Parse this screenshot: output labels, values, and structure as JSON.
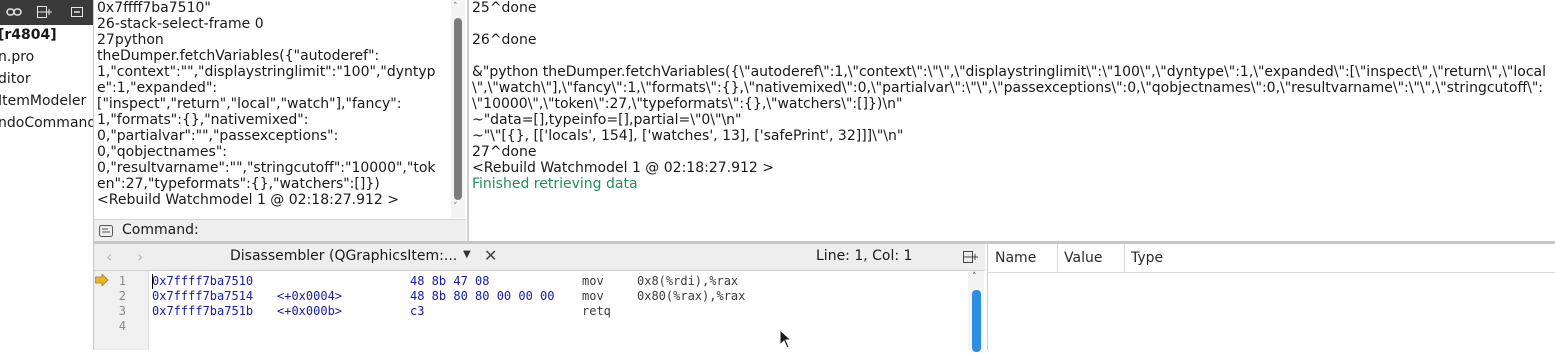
{
  "project_panel": {
    "toolbar_icons": [
      "link-icon",
      "split-icon",
      "close-pane-icon"
    ],
    "tree_items": [
      "[r4804]",
      "n.pro",
      "ditor",
      "ItemModeler",
      "ndoCommand"
    ]
  },
  "command_log": {
    "lines": [
      "0x7ffff7ba7510\"",
      "26-stack-select-frame 0",
      "27python",
      "theDumper.fetchVariables({\"autoderef\":",
      "1,\"context\":\"\",\"displaystringlimit\":\"100\",\"dyntyp",
      "e\":1,\"expanded\":",
      "[\"inspect\",\"return\",\"local\",\"watch\"],\"fancy\":",
      "1,\"formats\":{},\"nativemixed\":",
      "0,\"partialvar\":\"\",\"passexceptions\":",
      "0,\"qobjectnames\":",
      "0,\"resultvarname\":\"\",\"stringcutoff\":\"10000\",\"tok",
      "en\":27,\"typeformats\":{},\"watchers\":[]})",
      "<Rebuild Watchmodel 1 @ 02:18:27.912 >"
    ]
  },
  "command_bar": {
    "label": "Command:",
    "value": ""
  },
  "response_log": {
    "lines": [
      "25^done",
      "",
      "26^done",
      "",
      "&\"python theDumper.fetchVariables({\\\"autoderef\\\":1,\\\"context\\\":\\\"\\\",\\\"displaystringlimit\\\":\\\"100\\\",\\\"dyntype\\\":1,\\\"expanded\\\":[\\\"inspect\\\",\\\"return\\\",\\\"local",
      "\\\",\\\"watch\\\"],\\\"fancy\\\":1,\\\"formats\\\":{},\\\"nativemixed\\\":0,\\\"partialvar\\\":\\\"\\\",\\\"passexceptions\\\":0,\\\"qobjectnames\\\":0,\\\"resultvarname\\\":\\\"\\\",\\\"stringcutoff\\\":",
      "\\\"10000\\\",\\\"token\\\":27,\\\"typeformats\\\":{},\\\"watchers\\\":[]})\\n\"",
      "~\"data=[],typeinfo=[],partial=\\\"0\\\"\\n\"",
      "~\"\\\"[{}, [['locals', 154], ['watches', 13], ['safePrint', 32]]]\\\"\\n\"",
      "27^done",
      "<Rebuild Watchmodel 1 @ 02:18:27.912 >"
    ],
    "status_line": "Finished retrieving data",
    "status_color": "#1f8f5a"
  },
  "disassembler": {
    "title": "Disassembler (QGraphicsItem:...",
    "position": "Line: 1, Col: 1",
    "rows": [
      {
        "line": "1",
        "address": "0x7ffff7ba7510",
        "offset": "",
        "bytes": "48 8b 47 08",
        "mnemonic": "mov",
        "operands": "0x8(%rdi),%rax"
      },
      {
        "line": "2",
        "address": "0x7ffff7ba7514",
        "offset": "<+0x0004>",
        "bytes": "48 8b 80 80 00 00 00",
        "mnemonic": "mov",
        "operands": "0x80(%rax),%rax"
      },
      {
        "line": "3",
        "address": "0x7ffff7ba751b",
        "offset": "<+0x000b>",
        "bytes": "c3",
        "mnemonic": "retq",
        "operands": ""
      },
      {
        "line": "4",
        "address": "",
        "offset": "",
        "bytes": "",
        "mnemonic": "",
        "operands": ""
      }
    ],
    "current_line_marker": "arrow-marker-icon"
  },
  "locals_view": {
    "columns": [
      "Name",
      "Value",
      "Type"
    ]
  },
  "colors": {
    "toolbar_dark": "#3a3a3a",
    "accent_blue": "#2d8ee6",
    "marker_yellow": "#e8b430"
  }
}
